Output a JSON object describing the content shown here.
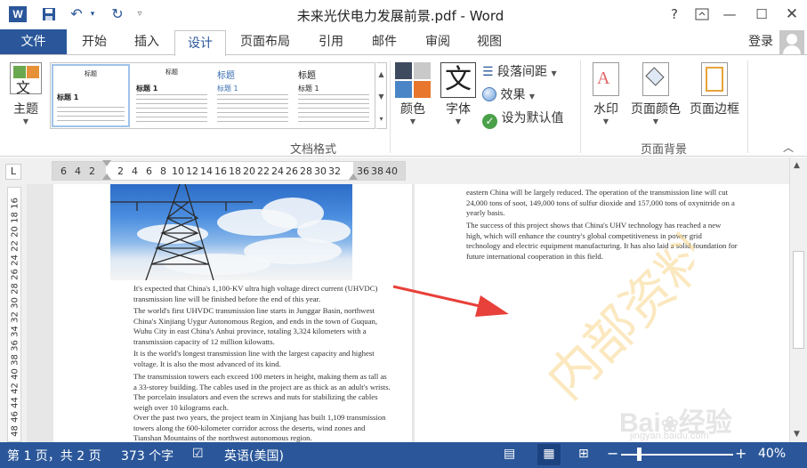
{
  "titlebar": {
    "app_logo": "W",
    "title": "未来光伏电力发展前景.pdf - Word",
    "help_label": "?",
    "icons": [
      "word-logo-icon",
      "save-icon",
      "undo-icon",
      "redo-icon",
      "customize-icon",
      "help-icon",
      "ribbon-display-icon",
      "minimize-icon",
      "maximize-icon",
      "close-icon"
    ]
  },
  "tabs": {
    "file": "文件",
    "items": [
      "开始",
      "插入",
      "设计",
      "页面布局",
      "引用",
      "邮件",
      "审阅",
      "视图"
    ],
    "active": "设计",
    "login": "登录"
  },
  "ribbon": {
    "theme_label": "主题",
    "gallery_thumbs": [
      {
        "title": "标题",
        "heading": "标题 1"
      },
      {
        "title": "标题",
        "heading": "标题 1"
      },
      {
        "title": "标题",
        "heading": "标题 1"
      },
      {
        "title": "标题",
        "heading": "标题 1"
      }
    ],
    "colors_label": "颜色",
    "fonts_label": "字体",
    "fonts_icon_char": "文",
    "paragraph_spacing_label": "段落间距",
    "effects_label": "效果",
    "set_default_label": "设为默认值",
    "group_document_format": "文档格式",
    "watermark_label": "水印",
    "page_color_label": "页面颜色",
    "page_border_label": "页面边框",
    "group_page_background": "页面背景"
  },
  "ruler": {
    "corner": "L",
    "left_numbers": [
      "6",
      "4",
      "2"
    ],
    "numbers": [
      "2",
      "4",
      "6",
      "8",
      "10",
      "12",
      "14",
      "16",
      "18",
      "20",
      "22",
      "24",
      "26",
      "28",
      "30",
      "32"
    ],
    "right_numbers": [
      "36",
      "38",
      "40"
    ],
    "vertical_numbers": [
      "16",
      "18",
      "20",
      "22",
      "24",
      "26",
      "28",
      "30",
      "32",
      "34",
      "36",
      "38",
      "40",
      "42",
      "44",
      "46",
      "48",
      "50"
    ]
  },
  "page1": {
    "paragraphs": [
      "It's expected that China's 1,100-KV ultra high voltage direct current (UHVDC) transmission line will be finished before the end of this year.",
      "The world's first UHVDC transmission line starts in Junggar Basin, northwest China's Xinjiang Uygur Autonomous Region, and ends in the town of Guquan, Wuhu City in east China's Anhui province, totaling 3,324 kilometers with a transmission capacity of 12 million kilowatts.",
      "It is the world's longest transmission line with the largest capacity and highest voltage. It is also the most advanced of its kind.",
      "The transmission towers each exceed 100 meters in height, making them as tall as a 33-storey building. The cables used in the project are as thick as an adult's wrists. The porcelain insulators and even the screws and nuts for stabilizing the cables weigh over 10 kilograms each.",
      "Over the past two years, the project team in Xinjiang has built 1,109 transmission towers along the 600-kilometer corridor across the deserts, wind zones and Tianshan Mountains of the northwest autonomous region."
    ]
  },
  "page2": {
    "paragraphs": [
      "eastern China will be largely reduced. The operation of the transmission line will cut 24,000 tons of soot, 149,000 tons of sulfur dioxide and 157,000 tons of oxynitride on a yearly basis.",
      "The success of this project shows that China's UHV technology has reached a new high, which will enhance the country's global competitiveness in power grid technology and electric equipment manufacturing. It has also laid a solid foundation for future international cooperation in this field."
    ]
  },
  "overlay": {
    "watermark_text": "内部资料",
    "baidu_text": "Bai",
    "baidu_jingyan": "经验",
    "url_text": "jingyan.baidu.com"
  },
  "status": {
    "page": "第 1 页，共 2 页",
    "words": "373 个字",
    "language": "英语(美国)",
    "zoom_minus": "−",
    "zoom_plus": "+",
    "zoom": "40%"
  },
  "colors": {
    "accent": "#2b579a",
    "arrow": "#e8403a"
  }
}
